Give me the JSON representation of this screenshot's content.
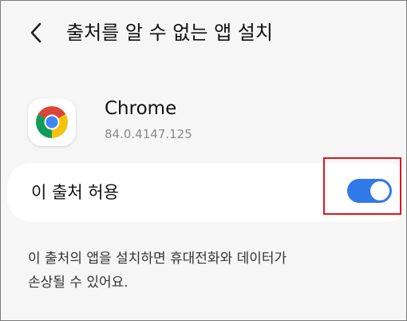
{
  "header": {
    "back_icon": "chevron-left-icon",
    "title": "출처를 알 수 없는 앱 설치"
  },
  "app": {
    "icon": "chrome-logo-icon",
    "name": "Chrome",
    "version": "84.0.4147.125"
  },
  "permission": {
    "label": "이 출처 허용",
    "enabled": true,
    "toggle_color": "#2f79e8"
  },
  "highlight_color": "#e0161b",
  "description": {
    "line1": "이 출처의 앱을 설치하면 휴대전화와 데이터가",
    "line2": "손상될 수 있어요."
  }
}
